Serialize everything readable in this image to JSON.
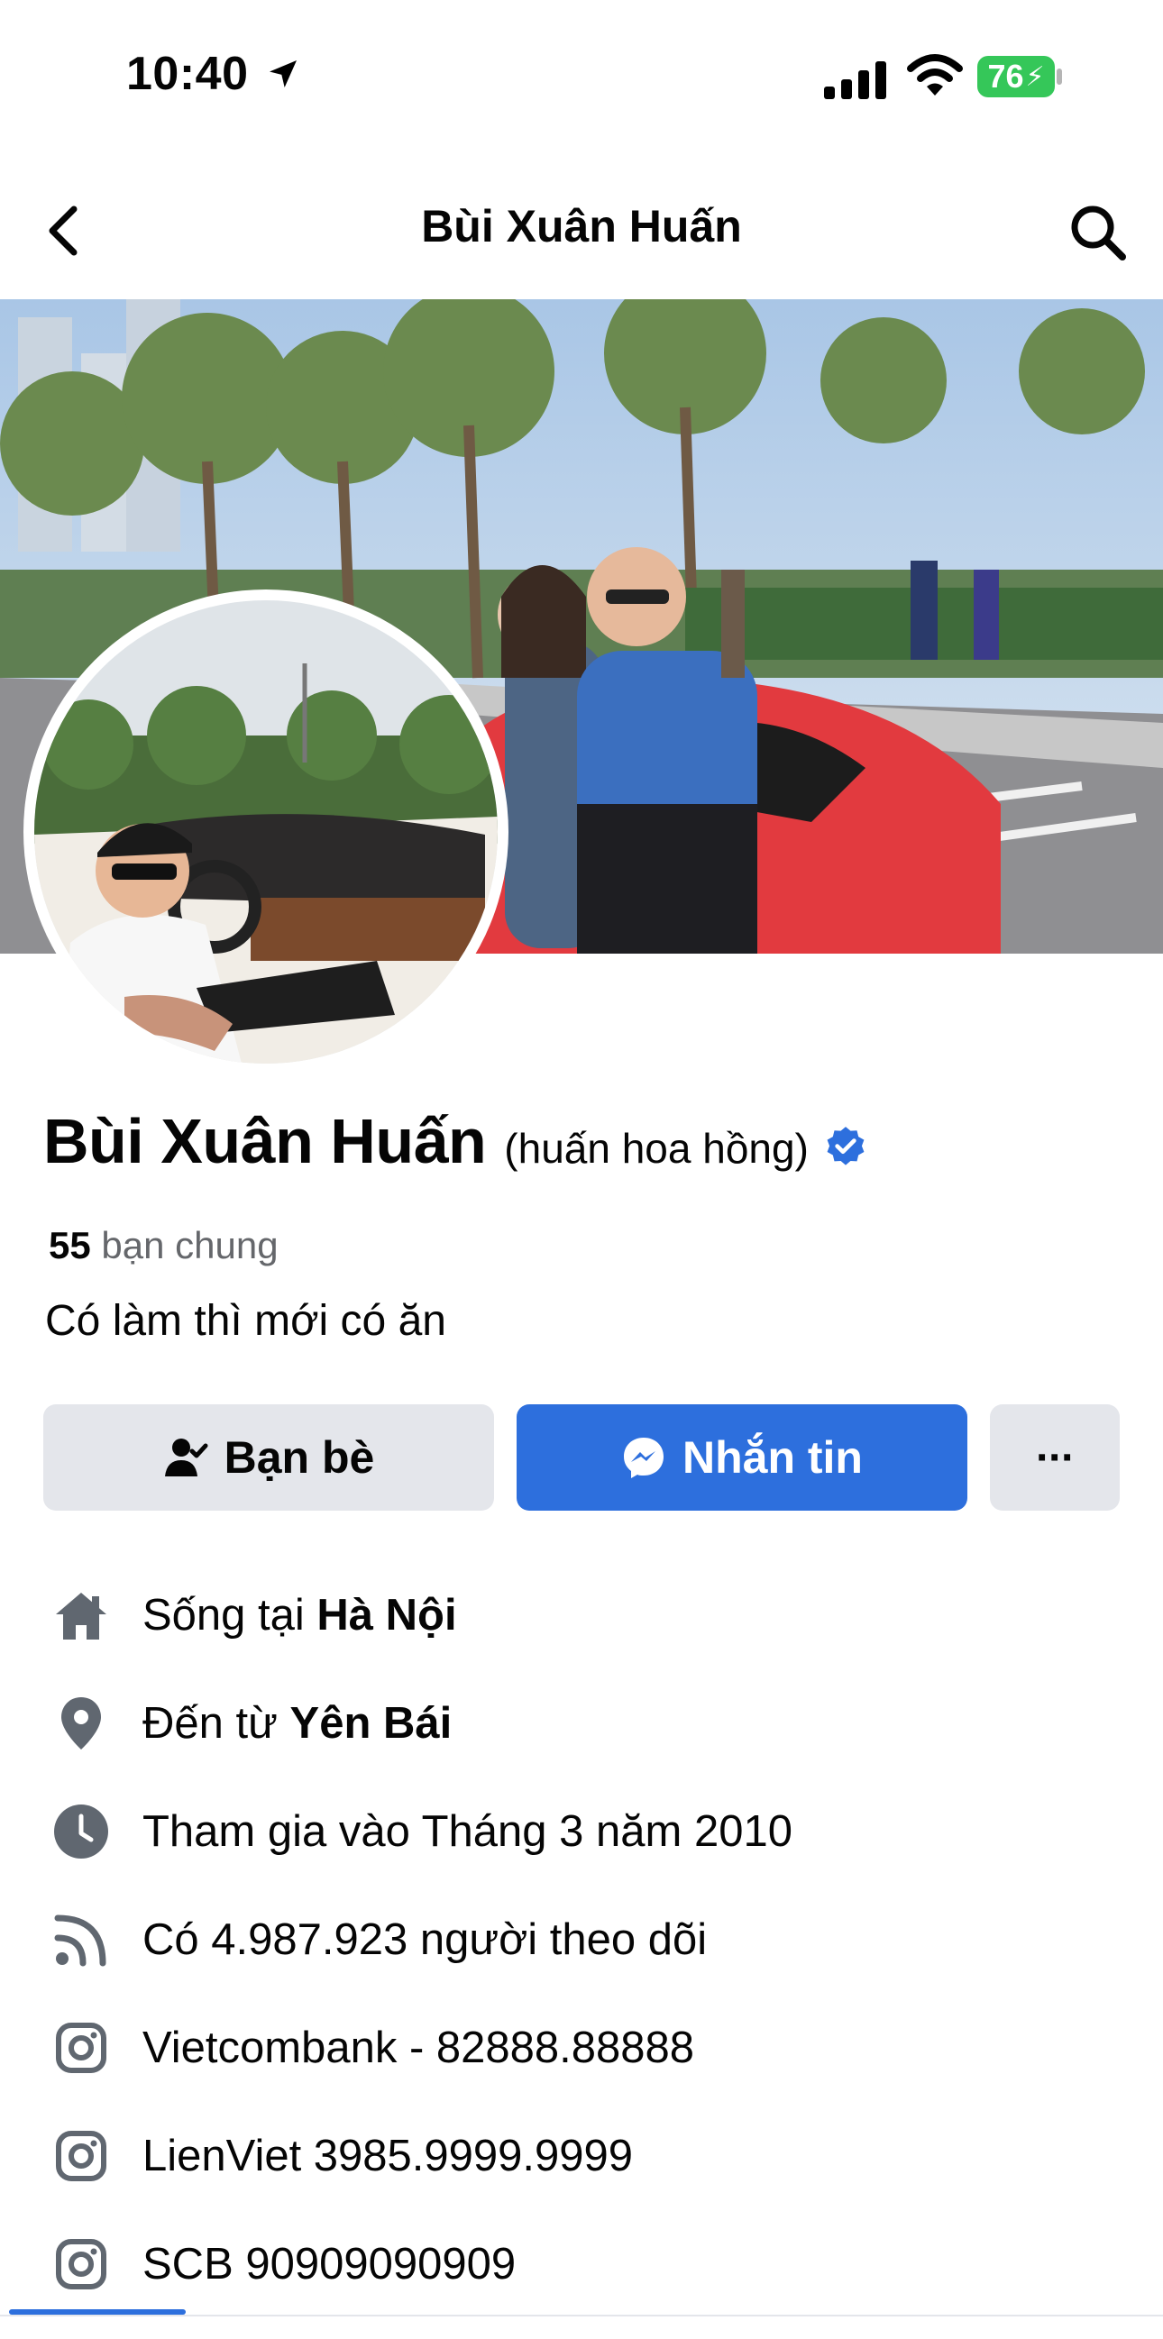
{
  "status_bar": {
    "time": "10:40",
    "battery": "76",
    "colors": {
      "battery": "#35c759"
    }
  },
  "header": {
    "title": "Bùi Xuân Huấn",
    "back_icon": "chevron-left-icon",
    "search_icon": "search-icon"
  },
  "profile": {
    "name": "Bùi Xuân Huấn",
    "alternate_name": "(huấn hoa hồng)",
    "verified": true,
    "mutual_count": "55",
    "mutual_label": " bạn chung",
    "bio": "Có làm thì mới có ăn"
  },
  "actions": {
    "friends_label": "Bạn bè",
    "message_label": "Nhắn tin",
    "more_label": "···",
    "colors": {
      "primary": "#2d6fdd",
      "secondary": "#e4e6eb"
    }
  },
  "details": {
    "lives_prefix": "Sống tại ",
    "lives_value": "Hà Nội",
    "from_prefix": "Đến từ ",
    "from_value": "Yên Bái",
    "joined": "Tham gia vào Tháng 3 năm 2010",
    "followers": "Có 4.987.923 người theo dõi",
    "link1": "Vietcombank - 82888.88888",
    "link2": "LienViet 3985.9999.9999",
    "link3": "SCB 90909090909"
  }
}
